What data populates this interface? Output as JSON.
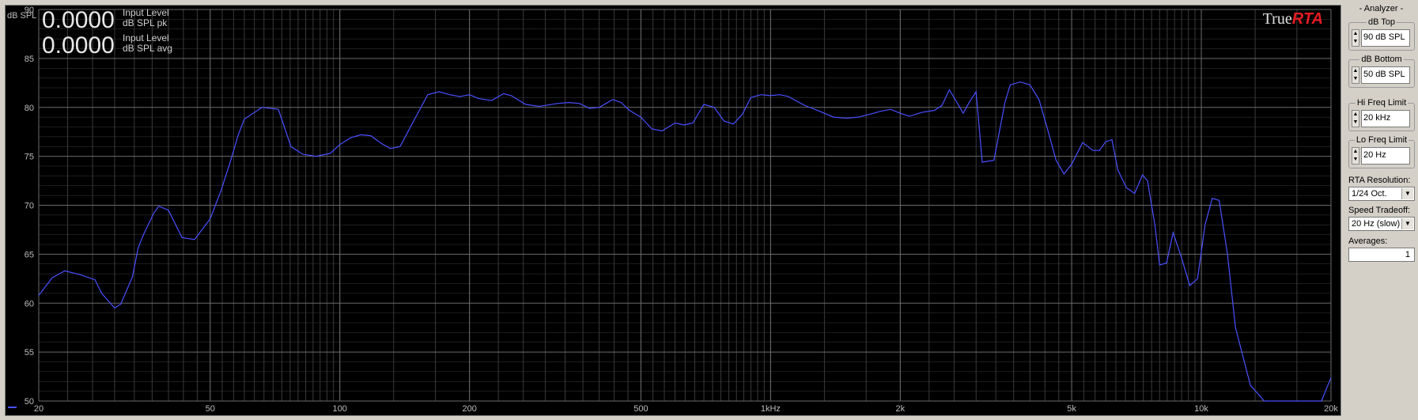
{
  "readouts": {
    "pk_value": "0.0000",
    "pk_label1": "Input Level",
    "pk_label2": "dB SPL pk",
    "avg_value": "0.0000",
    "avg_label1": "Input Level",
    "avg_label2": "dB SPL avg"
  },
  "brand": {
    "part1": "True",
    "part2": "RTA"
  },
  "colors": {
    "background": "#000000",
    "trace": "#4a50ff",
    "grid_major": "#6a6a6a",
    "grid_minor": "#3a3a3a",
    "label": "#bdbdbd",
    "brand_red": "#e51c23"
  },
  "chart_data": {
    "type": "line",
    "ylabel": "dB SPL",
    "ylim": [
      50,
      90
    ],
    "xlim": [
      20,
      20000
    ],
    "x_scale": "log",
    "grid": true,
    "y_ticks": [
      {
        "value": 90,
        "label": "90"
      },
      {
        "value": 85,
        "label": "85"
      },
      {
        "value": 80,
        "label": "80"
      },
      {
        "value": 75,
        "label": "75"
      },
      {
        "value": 70,
        "label": "70"
      },
      {
        "value": 65,
        "label": "65"
      },
      {
        "value": 60,
        "label": "60"
      },
      {
        "value": 55,
        "label": "55"
      },
      {
        "value": 50,
        "label": "50"
      }
    ],
    "x_ticks": [
      {
        "value": 20,
        "label": "20"
      },
      {
        "value": 50,
        "label": "50"
      },
      {
        "value": 100,
        "label": "100"
      },
      {
        "value": 200,
        "label": "200"
      },
      {
        "value": 500,
        "label": "500"
      },
      {
        "value": 1000,
        "label": "1kHz"
      },
      {
        "value": 2000,
        "label": "2k"
      },
      {
        "value": 5000,
        "label": "5k"
      },
      {
        "value": 10000,
        "label": "10k"
      },
      {
        "value": 20000,
        "label": "20k"
      }
    ],
    "series": [
      {
        "color": "#4a50ff",
        "x": [
          20,
          21.5,
          23,
          25,
          27,
          28,
          30,
          31,
          33,
          34,
          35,
          37,
          38,
          40,
          43,
          46,
          50,
          53,
          56,
          58,
          60,
          66,
          72,
          77,
          82,
          88,
          95,
          100,
          106,
          112,
          118,
          125,
          131,
          138,
          150,
          160,
          170,
          180,
          190,
          200,
          210,
          225,
          240,
          250,
          270,
          290,
          300,
          320,
          340,
          360,
          380,
          400,
          430,
          450,
          470,
          500,
          530,
          560,
          600,
          630,
          660,
          700,
          740,
          780,
          820,
          860,
          900,
          950,
          1000,
          1050,
          1100,
          1200,
          1250,
          1300,
          1400,
          1500,
          1600,
          1700,
          1800,
          1900,
          2000,
          2100,
          2250,
          2400,
          2500,
          2600,
          2700,
          2800,
          2900,
          3000,
          3100,
          3300,
          3500,
          3600,
          3800,
          4000,
          4200,
          4400,
          4600,
          4800,
          5000,
          5300,
          5600,
          5800,
          6000,
          6200,
          6400,
          6700,
          7000,
          7300,
          7500,
          7800,
          8000,
          8300,
          8600,
          9000,
          9400,
          9800,
          10200,
          10600,
          11000,
          11500,
          12000,
          13000,
          14000,
          15000,
          16000,
          17000,
          18000,
          19000,
          20000
        ],
        "y": [
          60.8,
          62.6,
          63.3,
          62.9,
          62.4,
          61.0,
          59.5,
          59.9,
          62.7,
          65.6,
          67.0,
          69.2,
          69.9,
          69.5,
          66.7,
          66.5,
          68.6,
          71.5,
          74.8,
          77.1,
          78.8,
          80.0,
          79.8,
          76.0,
          75.2,
          75.0,
          75.3,
          76.2,
          76.9,
          77.2,
          77.1,
          76.3,
          75.8,
          76.0,
          79.0,
          81.3,
          81.6,
          81.3,
          81.1,
          81.3,
          80.9,
          80.7,
          81.4,
          81.2,
          80.3,
          80.1,
          80.2,
          80.4,
          80.5,
          80.4,
          79.9,
          80.0,
          80.8,
          80.5,
          79.7,
          79.0,
          77.8,
          77.6,
          78.4,
          78.2,
          78.4,
          80.3,
          80.0,
          78.6,
          78.3,
          79.3,
          81.0,
          81.3,
          81.2,
          81.3,
          81.1,
          80.2,
          79.9,
          79.6,
          79.0,
          78.9,
          79.0,
          79.3,
          79.6,
          79.8,
          79.4,
          79.1,
          79.5,
          79.7,
          80.2,
          81.8,
          80.6,
          79.4,
          80.6,
          81.6,
          74.4,
          74.6,
          80.5,
          82.3,
          82.6,
          82.3,
          80.8,
          77.7,
          74.6,
          73.2,
          74.2,
          76.4,
          75.6,
          75.6,
          76.5,
          76.7,
          73.6,
          71.8,
          71.2,
          73.1,
          72.5,
          68.0,
          63.9,
          64.1,
          67.2,
          64.6,
          61.8,
          62.5,
          68.0,
          70.7,
          70.5,
          65.0,
          57.5,
          51.6,
          50.0,
          49.0,
          49.0,
          49.0,
          49.0,
          50.0,
          52.4
        ]
      }
    ]
  },
  "sidebar": {
    "title": "- Analyzer -",
    "db_top_label": "dB Top",
    "db_top_value": "90 dB SPL",
    "db_bottom_label": "dB Bottom",
    "db_bottom_value": "50 dB SPL",
    "hi_freq_label": "Hi Freq Limit",
    "hi_freq_value": "20 kHz",
    "lo_freq_label": "Lo Freq Limit",
    "lo_freq_value": "20 Hz",
    "rta_res_label": "RTA Resolution:",
    "rta_res_value": "1/24 Oct.",
    "speed_label": "Speed Tradeoff:",
    "speed_value": "20 Hz (slow)",
    "averages_label": "Averages:",
    "averages_value": "1"
  }
}
